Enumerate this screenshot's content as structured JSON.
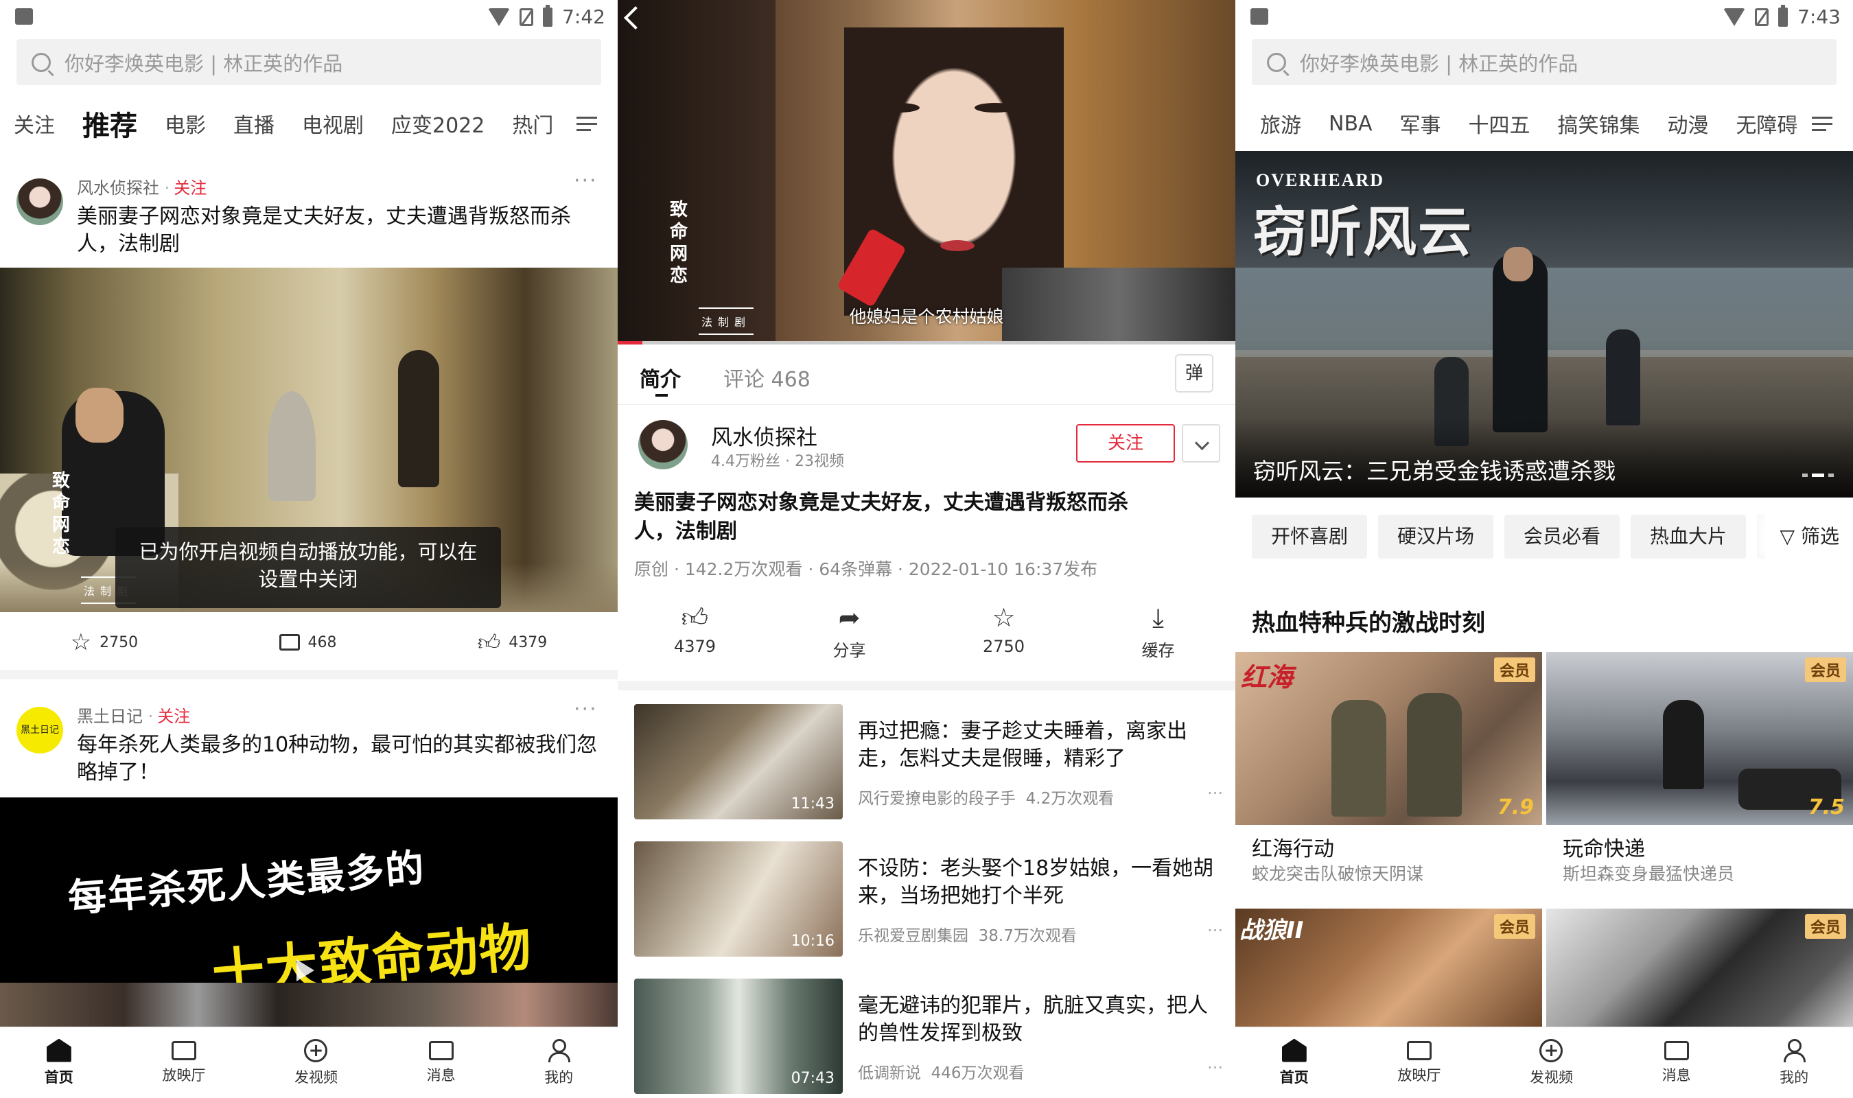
{
  "panel1": {
    "status": {
      "time": "7:42"
    },
    "search_placeholder": "你好李焕英电影 | 林正英的作品",
    "categories": [
      "关注",
      "推荐",
      "电影",
      "直播",
      "电视剧",
      "应变2022",
      "热门"
    ],
    "active_category": "推荐",
    "feed": [
      {
        "author": "风水侦探社",
        "follow": "关注",
        "title": "美丽妻子网恋对象竟是丈夫好友，丈夫遭遇背叛怒而杀人，法制剧",
        "video_vertical_title": "致命网恋",
        "video_badge": "法制剧",
        "toast": "已为你开启视频自动播放功能，可以在设置中关闭",
        "stars": "2750",
        "comments": "468",
        "likes": "4379"
      },
      {
        "author": "黑土日记",
        "follow": "关注",
        "avatar_text": "黑土日记",
        "title": "每年杀死人类最多的10种动物，最可怕的其实都被我们忽略掉了！",
        "video_line1": "每年杀死人类最多的",
        "video_line2": "十大致命动物"
      }
    ],
    "bottom_nav": [
      "首页",
      "放映厅",
      "发视频",
      "消息",
      "我的"
    ]
  },
  "panel2": {
    "video_vertical_title": "致命网恋",
    "video_badge": "法制剧",
    "subtitle": "他媳妇是个农村姑娘",
    "tabs": {
      "intro": "简介",
      "comments": "评论 468",
      "danmu": "弹"
    },
    "channel": {
      "name": "风水侦探社",
      "stats": "4.4万粉丝 · 23视频",
      "follow": "关注"
    },
    "title": "美丽妻子网恋对象竟是丈夫好友，丈夫遭遇背叛怒而杀人，法制剧",
    "meta": "原创 · 142.2万次观看 · 64条弹幕 · 2022-01-10 16:37发布",
    "actions": [
      {
        "label": "4379",
        "icon": "thumbs-up-icon"
      },
      {
        "label": "分享",
        "icon": "share-icon"
      },
      {
        "label": "2750",
        "icon": "star-icon"
      },
      {
        "label": "缓存",
        "icon": "download-icon"
      }
    ],
    "related": [
      {
        "title": "再过把瘾：妻子趁丈夫睡着，离家出走，怎料丈夫是假睡，精彩了",
        "source": "风行爱撩电影的段子手",
        "views": "4.2万次观看",
        "duration": "11:43"
      },
      {
        "title": "不设防：老头娶个18岁姑娘，一看她胡来，当场把她打个半死",
        "source": "乐视爱豆剧集园",
        "views": "38.7万次观看",
        "duration": "10:16"
      },
      {
        "title": "毫无避讳的犯罪片，肮脏又真实，把人的兽性发挥到极致",
        "source": "低调新说",
        "views": "446万次观看",
        "duration": "07:43"
      }
    ]
  },
  "panel3": {
    "status": {
      "time": "7:43"
    },
    "search_placeholder": "你好李焕英电影 | 林正英的作品",
    "categories": [
      "旅游",
      "NBA",
      "军事",
      "十四五",
      "搞笑锦集",
      "动漫",
      "无障碍"
    ],
    "banner": {
      "logo_en": "OVERHEARD",
      "logo_cn": "窃听风云",
      "caption": "窃听风云：三兄弟受金钱诱惑遭杀戮"
    },
    "chips": [
      "开怀喜剧",
      "硬汉片场",
      "会员必看",
      "热血大片"
    ],
    "filter": "筛选",
    "section_title": "热血特种兵的激战时刻",
    "cards": [
      {
        "title": "红海行动",
        "subtitle": "蛟龙突击队破惊天阴谋",
        "badge": "会员",
        "score": "7.9",
        "poster_text": "红海"
      },
      {
        "title": "玩命快递",
        "subtitle": "斯坦森变身最猛快递员",
        "badge": "会员",
        "score": "7.5"
      },
      {
        "title": "",
        "subtitle": "",
        "badge": "会员",
        "poster_text": "战狼II"
      },
      {
        "title": "",
        "subtitle": "",
        "badge": "会员"
      }
    ],
    "bottom_nav": [
      "首页",
      "放映厅",
      "发视频",
      "消息",
      "我的"
    ]
  }
}
